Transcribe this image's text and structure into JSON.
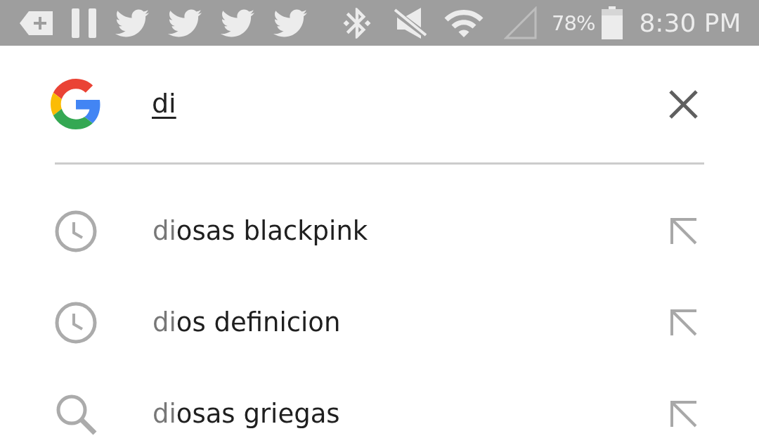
{
  "status_bar": {
    "battery_text": "78%",
    "time": "8:30 PM"
  },
  "search": {
    "query": "di"
  },
  "suggestions": [
    {
      "kind": "history",
      "match": "di",
      "rest": "osas blackpink"
    },
    {
      "kind": "history",
      "match": "di",
      "rest": "os definicion"
    },
    {
      "kind": "search",
      "match": "di",
      "rest": "osas griegas"
    }
  ]
}
